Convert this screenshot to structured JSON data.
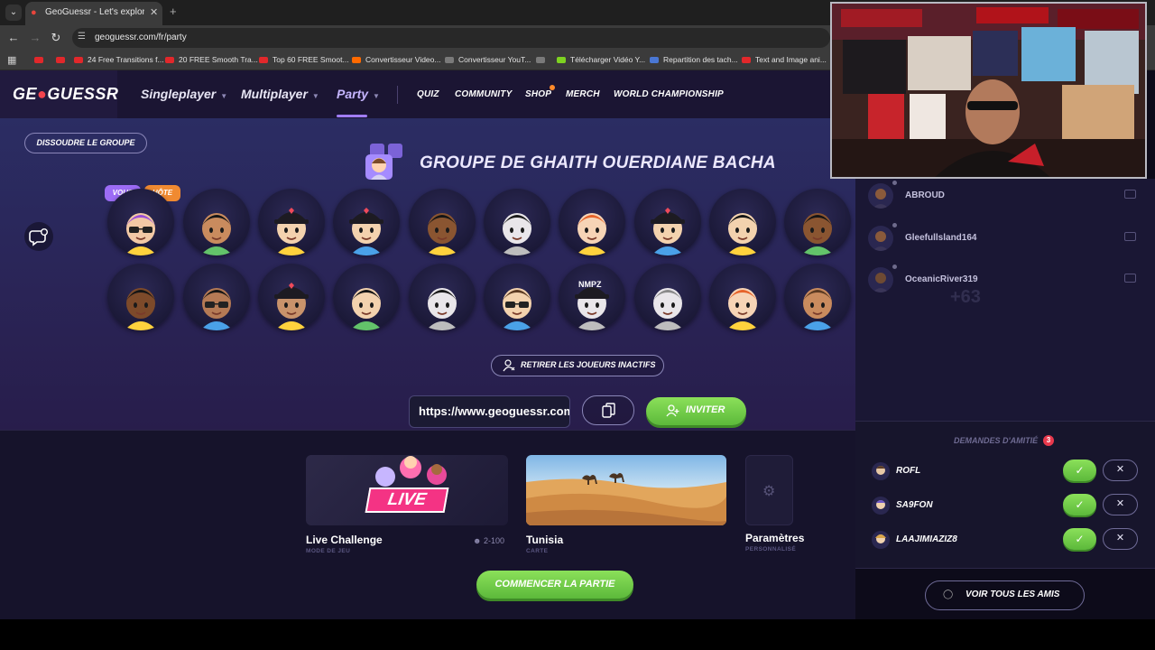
{
  "browser": {
    "tab_title": "GeoGuessr - Let's explore the w",
    "url": "geoguessr.com/fr/party",
    "bookmarks": [
      {
        "label": "",
        "color": "#e1282b"
      },
      {
        "label": "",
        "color": "#e1282b"
      },
      {
        "label": "24 Free Transitions f...",
        "color": "#e1282b"
      },
      {
        "label": "20 FREE Smooth Tra...",
        "color": "#e1282b"
      },
      {
        "label": "Top 60 FREE Smoot...",
        "color": "#e1282b"
      },
      {
        "label": "Convertisseur Video...",
        "color": "#ff6a00"
      },
      {
        "label": "Convertisseur YouT...",
        "color": "#7a7a7a"
      },
      {
        "label": "",
        "color": "#7a7a7a"
      },
      {
        "label": "Télécharger Vidéo Y...",
        "color": "#7ed321"
      },
      {
        "label": "Repartition des tach...",
        "color": "#4a77d4"
      },
      {
        "label": "Text and Image ani...",
        "color": "#e1282b"
      }
    ]
  },
  "header": {
    "logo_left": "GE",
    "logo_right": "GUESSR",
    "nav": {
      "singleplayer": "Singleplayer",
      "multiplayer": "Multiplayer",
      "party": "Party",
      "quiz": "QUIZ",
      "community": "COMMUNITY",
      "shop": "SHOP",
      "merch": "MERCH",
      "world_championship": "WORLD CHAMPIONSHIP"
    }
  },
  "party": {
    "dissolve_label": "DISSOUDRE LE GROUPE",
    "group_title": "GROUPE DE GHAITH OUERDIANE BACHA",
    "tag_you": "VOUS",
    "tag_host": "HÔTE",
    "remove_inactive_label": "RETIRER LES JOUEURS INACTIFS",
    "invite_link": "https://www.geoguessr.com/fr/party",
    "invite_label": "INVITER",
    "nmpz_text": "NMPZ"
  },
  "game": {
    "mode_title": "Live Challenge",
    "mode_sub": "MODE DE JEU",
    "live_badge": "LIVE",
    "players": "2-100",
    "map_title": "Tunisia",
    "map_sub": "CARTE",
    "params_title": "Paramètres",
    "params_sub": "PERSONNALISÉ",
    "start_label": "COMMENCER LA PARTIE"
  },
  "friends": {
    "list": [
      {
        "name": "ABROUD"
      },
      {
        "name": "Gleefullsland164"
      },
      {
        "name": "OceanicRiver319"
      }
    ],
    "more_count": "+63",
    "requests_title": "DEMANDES D'AMITIÉ",
    "requests_count": "3",
    "requests": [
      {
        "name": "ROFL"
      },
      {
        "name": "SA9FON"
      },
      {
        "name": "LAAJIMIAZIZ8"
      }
    ],
    "view_all_label": "VOIR TOUS LES AMIS"
  },
  "colors": {
    "accent_green": "#5cb93b",
    "accent_purple": "#a17dff",
    "tag_you": "#9c6cf6",
    "tag_host": "#f08a31",
    "live_pink": "#f43384"
  }
}
